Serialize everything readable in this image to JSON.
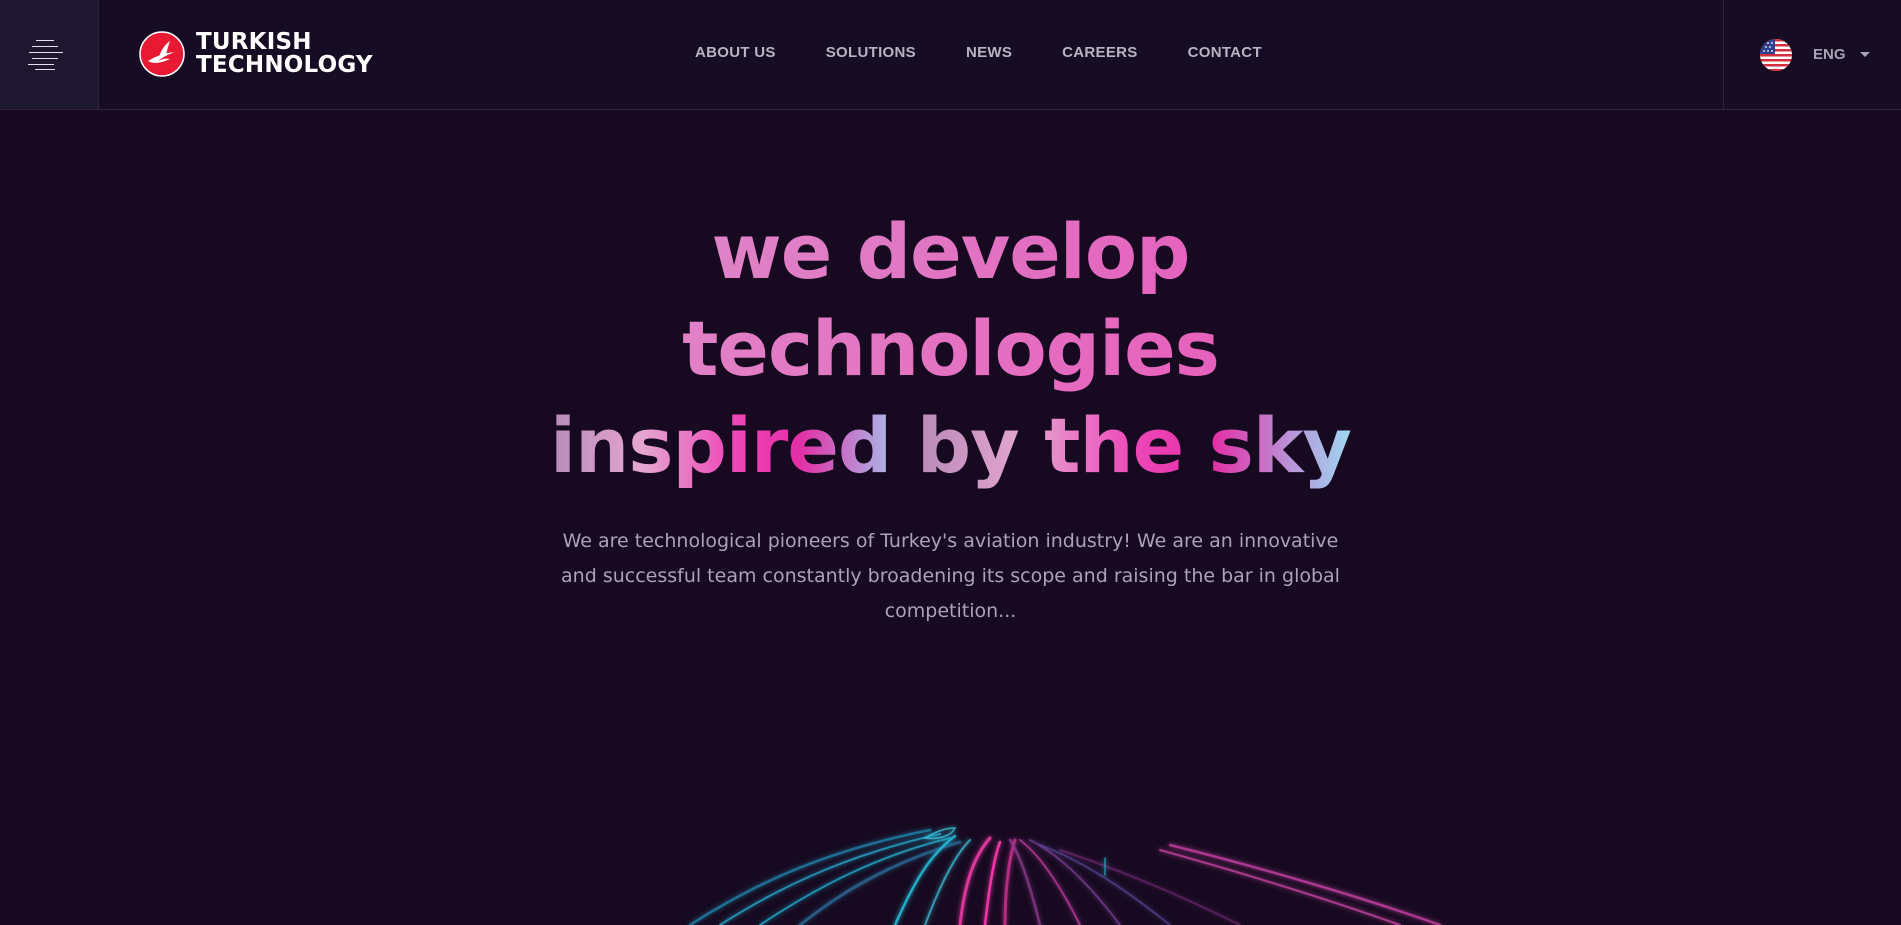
{
  "header": {
    "menu_icon": "hamburger-icon",
    "logo": {
      "line1": "TURKISH",
      "line2": "TECHNOLOGY",
      "icon": "turkish-airlines-bird-icon",
      "brand_color": "#e81932"
    },
    "nav": [
      {
        "label": "ABOUT US"
      },
      {
        "label": "SOLUTIONS"
      },
      {
        "label": "NEWS"
      },
      {
        "label": "CAREERS"
      },
      {
        "label": "CONTACT"
      }
    ],
    "language": {
      "label": "ENG",
      "flag_icon": "us-flag-icon"
    }
  },
  "hero": {
    "title_line1": "we develop",
    "title_line2": "technologies",
    "title_line3_a": "inspired ",
    "title_line3_b": "by the sky",
    "description": "We are technological pioneers of Turkey's aviation industry! We are an innovative and successful team constantly broadening its scope and raising the bar in global competition..."
  },
  "colors": {
    "background": "#170a20",
    "accent_pink": "#ee2fb0",
    "accent_light_pink": "#d7a6d2",
    "accent_cyan": "#1fb6d6",
    "accent_light_blue": "#9fd8f3"
  }
}
